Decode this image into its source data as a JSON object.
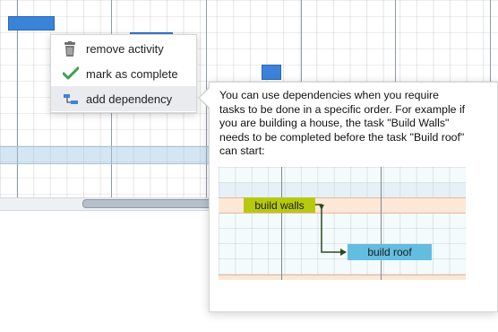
{
  "context_menu": {
    "items": [
      {
        "label": "remove activity",
        "icon": "trash-icon"
      },
      {
        "label": "mark as complete",
        "icon": "check-icon"
      },
      {
        "label": "add dependency",
        "icon": "dependency-icon"
      }
    ]
  },
  "tooltip": {
    "text": "You can use dependencies when you require tasks to be done in a specific order. For example if you are building a house, the task \"Build Walls\" needs to be completed before the task \"Build roof\" can start:",
    "illustration": {
      "task_a": {
        "label": "build walls",
        "color": "#b7c90f"
      },
      "task_b": {
        "label": "build roof",
        "color": "#63bde0"
      },
      "arrow_color": "#2c4a1c"
    }
  },
  "colors": {
    "task_bar": "#3b83d9",
    "selected_row": "#cfe3f2",
    "check_green": "#3aa14f"
  }
}
